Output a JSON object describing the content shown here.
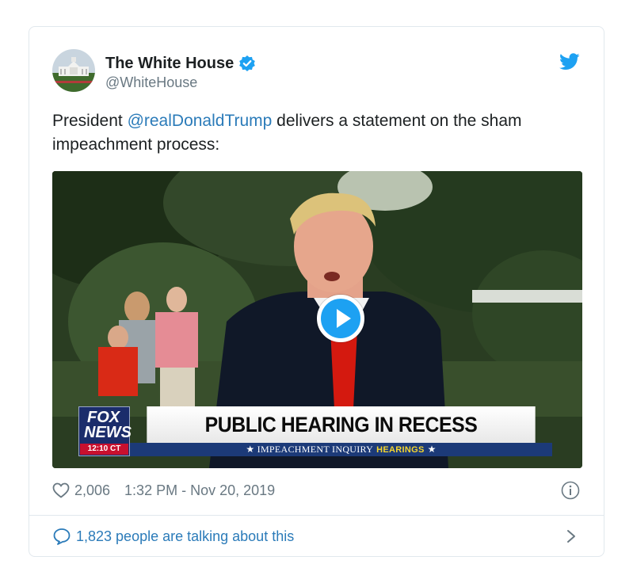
{
  "tweet": {
    "display_name": "The White House",
    "handle": "@WhiteHouse",
    "text_before": "President ",
    "mention": "@realDonaldTrump",
    "text_after": " delivers a statement on the sham impeachment process:",
    "likes": "2,006",
    "timestamp": "1:32 PM - Nov 20, 2019",
    "talking": "1,823 people are talking about this"
  },
  "video": {
    "chyron_main": "PUBLIC HEARING IN RECESS",
    "chyron_sub_before": "★ IMPEACHMENT INQUIRY",
    "chyron_sub_highlight": "HEARINGS",
    "chyron_sub_after": "★",
    "logo_line1": "FOX",
    "logo_line2": "NEWS",
    "clock": "12:10 CT"
  },
  "icons": {
    "verified": "verified-badge-icon",
    "bird": "twitter-bird-icon",
    "play": "play-icon",
    "heart": "heart-icon",
    "info": "info-icon",
    "bubble": "comment-bubble-icon",
    "chevron": "chevron-right-icon"
  },
  "colors": {
    "link": "#2b7bb9",
    "twitter_blue": "#1da1f2",
    "muted": "#697882",
    "border": "#e1e8ed"
  }
}
